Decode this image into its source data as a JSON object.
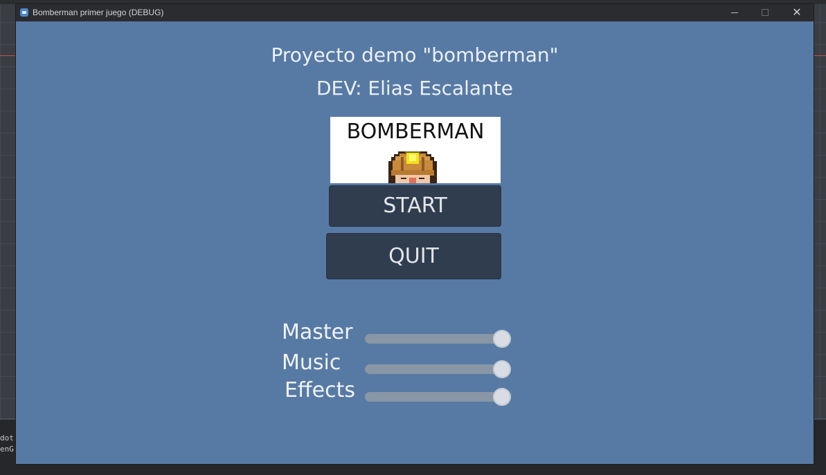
{
  "window": {
    "title": "Bomberman primer juego (DEBUG)",
    "minimize_glyph": "",
    "close_glyph": "✕"
  },
  "menu": {
    "title": "Proyecto demo \"bomberman\"",
    "subtitle": "DEV: Elias Escalante",
    "logo_text": "BOMBERMAN",
    "start_label": "START",
    "quit_label": "QUIT"
  },
  "volume": {
    "master": {
      "label": "Master",
      "value": 1.0
    },
    "music": {
      "label": "Music",
      "value": 1.0
    },
    "effects": {
      "label": "Effects",
      "value": 1.0
    }
  },
  "editor": {
    "console_lines": [
      "dot",
      "enG"
    ]
  },
  "colors": {
    "window_bg": "#577aa5",
    "button_bg": "#2f3d4f",
    "text": "#ecf0f5"
  }
}
